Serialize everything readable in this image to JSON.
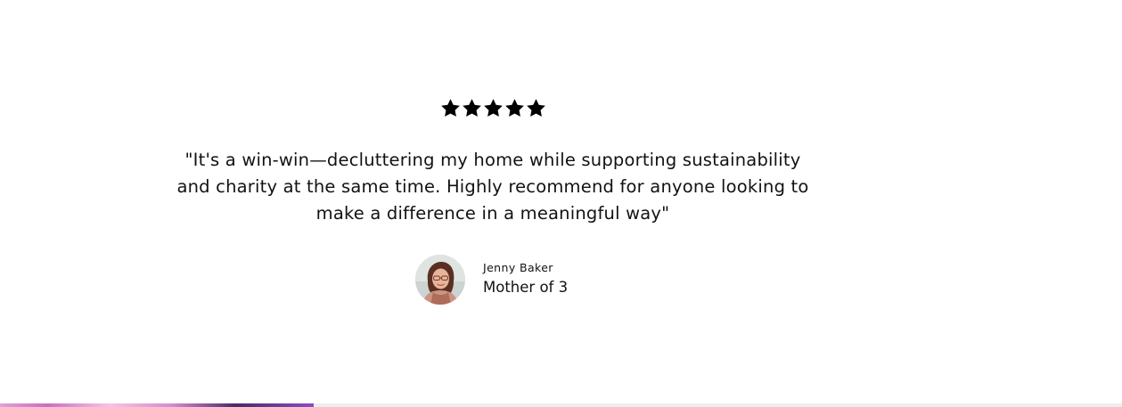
{
  "testimonial": {
    "rating": 5,
    "rating_max": 5,
    "star_color": "#000000",
    "quote_lines": [
      "\"It's a win-win—decluttering my home while supporting sustainability",
      "and charity at the same time. Highly recommend for anyone looking to",
      "make a difference in a meaningful way\""
    ],
    "author": {
      "name": "Jenny Baker",
      "role": "Mother of 3",
      "avatar_icon": "avatar-photo"
    }
  }
}
